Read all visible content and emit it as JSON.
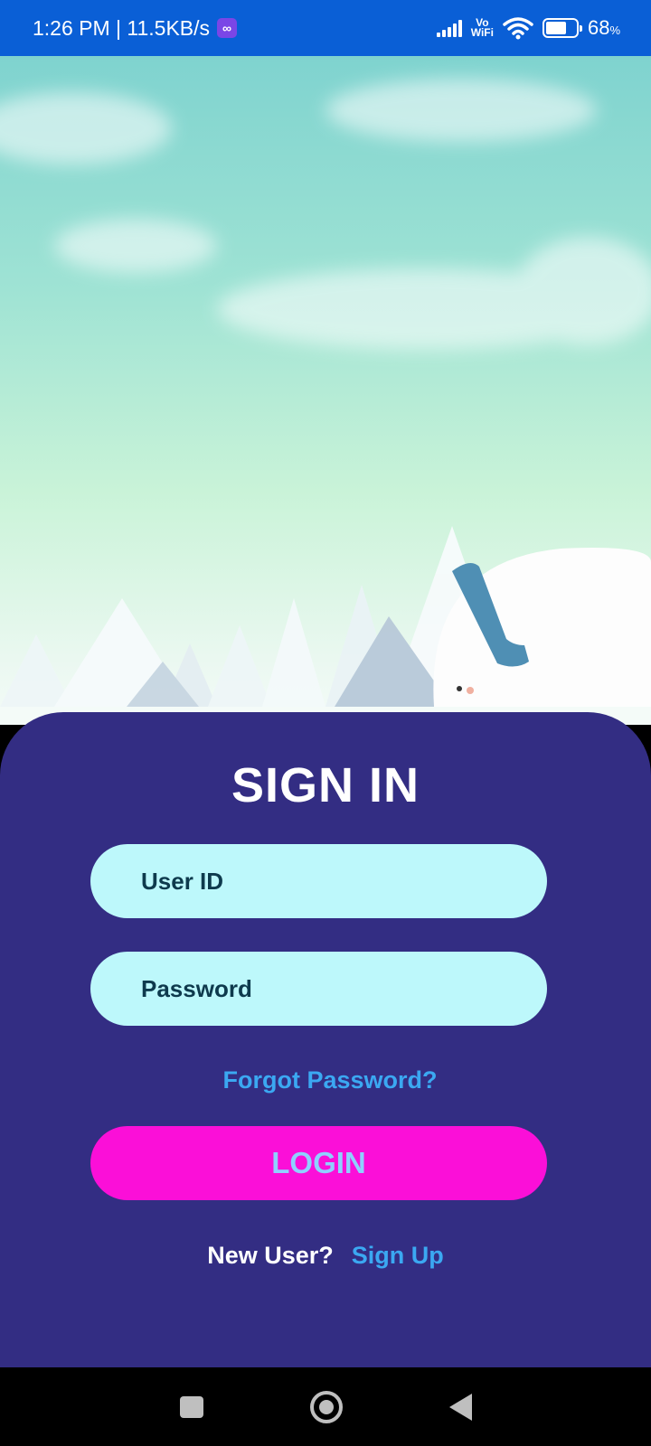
{
  "status_bar": {
    "time_speed": "1:26 PM | 11.5KB/s",
    "app_icon_glyph": "∞",
    "vowifi_top": "Vo",
    "vowifi_bottom": "WiFi",
    "battery_level": 0.68,
    "battery_percent": "68",
    "battery_unit": "%"
  },
  "signin": {
    "title": "SIGN IN",
    "user_id_placeholder": "User ID",
    "password_placeholder": "Password",
    "forgot_password": "Forgot Password?",
    "login_label": "LOGIN",
    "new_user_label": "New User?",
    "sign_up_label": "Sign Up"
  },
  "colors": {
    "status_bar": "#0a5fd6",
    "card": "#332d83",
    "input_bg": "#bdf8fb",
    "login_button": "#fb0fd8",
    "link": "#3ba8f2"
  },
  "icons": {
    "nav_recents": "square-icon",
    "nav_home": "circle-icon",
    "nav_back": "triangle-back-icon"
  }
}
